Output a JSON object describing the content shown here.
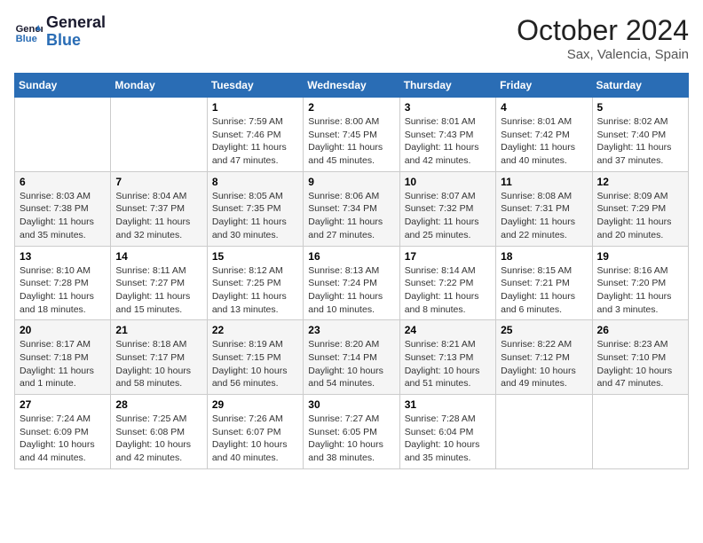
{
  "header": {
    "logo_line1": "General",
    "logo_line2": "Blue",
    "month_title": "October 2024",
    "location": "Sax, Valencia, Spain"
  },
  "weekdays": [
    "Sunday",
    "Monday",
    "Tuesday",
    "Wednesday",
    "Thursday",
    "Friday",
    "Saturday"
  ],
  "weeks": [
    [
      {
        "day": "",
        "info": ""
      },
      {
        "day": "",
        "info": ""
      },
      {
        "day": "1",
        "info": "Sunrise: 7:59 AM\nSunset: 7:46 PM\nDaylight: 11 hours and 47 minutes."
      },
      {
        "day": "2",
        "info": "Sunrise: 8:00 AM\nSunset: 7:45 PM\nDaylight: 11 hours and 45 minutes."
      },
      {
        "day": "3",
        "info": "Sunrise: 8:01 AM\nSunset: 7:43 PM\nDaylight: 11 hours and 42 minutes."
      },
      {
        "day": "4",
        "info": "Sunrise: 8:01 AM\nSunset: 7:42 PM\nDaylight: 11 hours and 40 minutes."
      },
      {
        "day": "5",
        "info": "Sunrise: 8:02 AM\nSunset: 7:40 PM\nDaylight: 11 hours and 37 minutes."
      }
    ],
    [
      {
        "day": "6",
        "info": "Sunrise: 8:03 AM\nSunset: 7:38 PM\nDaylight: 11 hours and 35 minutes."
      },
      {
        "day": "7",
        "info": "Sunrise: 8:04 AM\nSunset: 7:37 PM\nDaylight: 11 hours and 32 minutes."
      },
      {
        "day": "8",
        "info": "Sunrise: 8:05 AM\nSunset: 7:35 PM\nDaylight: 11 hours and 30 minutes."
      },
      {
        "day": "9",
        "info": "Sunrise: 8:06 AM\nSunset: 7:34 PM\nDaylight: 11 hours and 27 minutes."
      },
      {
        "day": "10",
        "info": "Sunrise: 8:07 AM\nSunset: 7:32 PM\nDaylight: 11 hours and 25 minutes."
      },
      {
        "day": "11",
        "info": "Sunrise: 8:08 AM\nSunset: 7:31 PM\nDaylight: 11 hours and 22 minutes."
      },
      {
        "day": "12",
        "info": "Sunrise: 8:09 AM\nSunset: 7:29 PM\nDaylight: 11 hours and 20 minutes."
      }
    ],
    [
      {
        "day": "13",
        "info": "Sunrise: 8:10 AM\nSunset: 7:28 PM\nDaylight: 11 hours and 18 minutes."
      },
      {
        "day": "14",
        "info": "Sunrise: 8:11 AM\nSunset: 7:27 PM\nDaylight: 11 hours and 15 minutes."
      },
      {
        "day": "15",
        "info": "Sunrise: 8:12 AM\nSunset: 7:25 PM\nDaylight: 11 hours and 13 minutes."
      },
      {
        "day": "16",
        "info": "Sunrise: 8:13 AM\nSunset: 7:24 PM\nDaylight: 11 hours and 10 minutes."
      },
      {
        "day": "17",
        "info": "Sunrise: 8:14 AM\nSunset: 7:22 PM\nDaylight: 11 hours and 8 minutes."
      },
      {
        "day": "18",
        "info": "Sunrise: 8:15 AM\nSunset: 7:21 PM\nDaylight: 11 hours and 6 minutes."
      },
      {
        "day": "19",
        "info": "Sunrise: 8:16 AM\nSunset: 7:20 PM\nDaylight: 11 hours and 3 minutes."
      }
    ],
    [
      {
        "day": "20",
        "info": "Sunrise: 8:17 AM\nSunset: 7:18 PM\nDaylight: 11 hours and 1 minute."
      },
      {
        "day": "21",
        "info": "Sunrise: 8:18 AM\nSunset: 7:17 PM\nDaylight: 10 hours and 58 minutes."
      },
      {
        "day": "22",
        "info": "Sunrise: 8:19 AM\nSunset: 7:15 PM\nDaylight: 10 hours and 56 minutes."
      },
      {
        "day": "23",
        "info": "Sunrise: 8:20 AM\nSunset: 7:14 PM\nDaylight: 10 hours and 54 minutes."
      },
      {
        "day": "24",
        "info": "Sunrise: 8:21 AM\nSunset: 7:13 PM\nDaylight: 10 hours and 51 minutes."
      },
      {
        "day": "25",
        "info": "Sunrise: 8:22 AM\nSunset: 7:12 PM\nDaylight: 10 hours and 49 minutes."
      },
      {
        "day": "26",
        "info": "Sunrise: 8:23 AM\nSunset: 7:10 PM\nDaylight: 10 hours and 47 minutes."
      }
    ],
    [
      {
        "day": "27",
        "info": "Sunrise: 7:24 AM\nSunset: 6:09 PM\nDaylight: 10 hours and 44 minutes."
      },
      {
        "day": "28",
        "info": "Sunrise: 7:25 AM\nSunset: 6:08 PM\nDaylight: 10 hours and 42 minutes."
      },
      {
        "day": "29",
        "info": "Sunrise: 7:26 AM\nSunset: 6:07 PM\nDaylight: 10 hours and 40 minutes."
      },
      {
        "day": "30",
        "info": "Sunrise: 7:27 AM\nSunset: 6:05 PM\nDaylight: 10 hours and 38 minutes."
      },
      {
        "day": "31",
        "info": "Sunrise: 7:28 AM\nSunset: 6:04 PM\nDaylight: 10 hours and 35 minutes."
      },
      {
        "day": "",
        "info": ""
      },
      {
        "day": "",
        "info": ""
      }
    ]
  ]
}
